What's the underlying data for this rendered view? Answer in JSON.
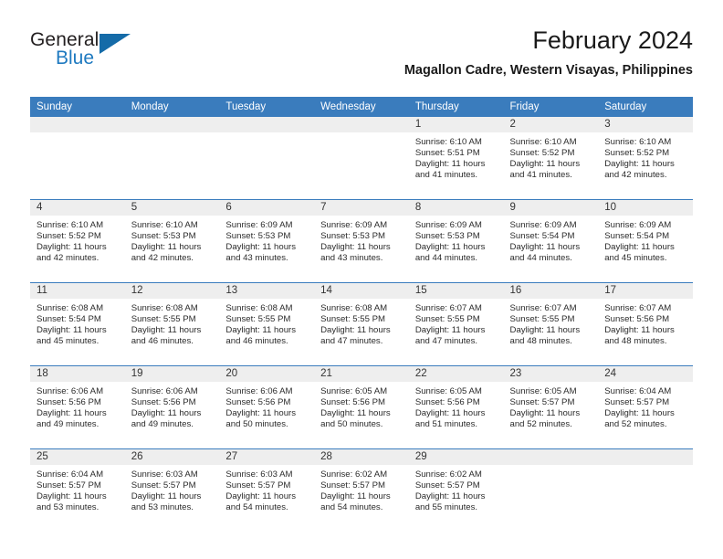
{
  "brand": {
    "name_part1": "General",
    "name_part2": "Blue",
    "flag_icon": "triangle-flag-icon",
    "accent_color": "#1f7ac0"
  },
  "header": {
    "title": "February 2024",
    "subtitle": "Magallon Cadre, Western Visayas, Philippines"
  },
  "theme": {
    "header_row_bg": "#3a7cbd",
    "daynum_band_bg": "#eeeeee",
    "grid_line": "#3a7cbd",
    "text": "#2b2b2b"
  },
  "weekday_headers": [
    "Sunday",
    "Monday",
    "Tuesday",
    "Wednesday",
    "Thursday",
    "Friday",
    "Saturday"
  ],
  "weeks": [
    [
      {
        "day": "",
        "lines": []
      },
      {
        "day": "",
        "lines": []
      },
      {
        "day": "",
        "lines": []
      },
      {
        "day": "",
        "lines": []
      },
      {
        "day": "1",
        "lines": [
          "Sunrise: 6:10 AM",
          "Sunset: 5:51 PM",
          "Daylight: 11 hours",
          "and 41 minutes."
        ]
      },
      {
        "day": "2",
        "lines": [
          "Sunrise: 6:10 AM",
          "Sunset: 5:52 PM",
          "Daylight: 11 hours",
          "and 41 minutes."
        ]
      },
      {
        "day": "3",
        "lines": [
          "Sunrise: 6:10 AM",
          "Sunset: 5:52 PM",
          "Daylight: 11 hours",
          "and 42 minutes."
        ]
      }
    ],
    [
      {
        "day": "4",
        "lines": [
          "Sunrise: 6:10 AM",
          "Sunset: 5:52 PM",
          "Daylight: 11 hours",
          "and 42 minutes."
        ]
      },
      {
        "day": "5",
        "lines": [
          "Sunrise: 6:10 AM",
          "Sunset: 5:53 PM",
          "Daylight: 11 hours",
          "and 42 minutes."
        ]
      },
      {
        "day": "6",
        "lines": [
          "Sunrise: 6:09 AM",
          "Sunset: 5:53 PM",
          "Daylight: 11 hours",
          "and 43 minutes."
        ]
      },
      {
        "day": "7",
        "lines": [
          "Sunrise: 6:09 AM",
          "Sunset: 5:53 PM",
          "Daylight: 11 hours",
          "and 43 minutes."
        ]
      },
      {
        "day": "8",
        "lines": [
          "Sunrise: 6:09 AM",
          "Sunset: 5:53 PM",
          "Daylight: 11 hours",
          "and 44 minutes."
        ]
      },
      {
        "day": "9",
        "lines": [
          "Sunrise: 6:09 AM",
          "Sunset: 5:54 PM",
          "Daylight: 11 hours",
          "and 44 minutes."
        ]
      },
      {
        "day": "10",
        "lines": [
          "Sunrise: 6:09 AM",
          "Sunset: 5:54 PM",
          "Daylight: 11 hours",
          "and 45 minutes."
        ]
      }
    ],
    [
      {
        "day": "11",
        "lines": [
          "Sunrise: 6:08 AM",
          "Sunset: 5:54 PM",
          "Daylight: 11 hours",
          "and 45 minutes."
        ]
      },
      {
        "day": "12",
        "lines": [
          "Sunrise: 6:08 AM",
          "Sunset: 5:55 PM",
          "Daylight: 11 hours",
          "and 46 minutes."
        ]
      },
      {
        "day": "13",
        "lines": [
          "Sunrise: 6:08 AM",
          "Sunset: 5:55 PM",
          "Daylight: 11 hours",
          "and 46 minutes."
        ]
      },
      {
        "day": "14",
        "lines": [
          "Sunrise: 6:08 AM",
          "Sunset: 5:55 PM",
          "Daylight: 11 hours",
          "and 47 minutes."
        ]
      },
      {
        "day": "15",
        "lines": [
          "Sunrise: 6:07 AM",
          "Sunset: 5:55 PM",
          "Daylight: 11 hours",
          "and 47 minutes."
        ]
      },
      {
        "day": "16",
        "lines": [
          "Sunrise: 6:07 AM",
          "Sunset: 5:55 PM",
          "Daylight: 11 hours",
          "and 48 minutes."
        ]
      },
      {
        "day": "17",
        "lines": [
          "Sunrise: 6:07 AM",
          "Sunset: 5:56 PM",
          "Daylight: 11 hours",
          "and 48 minutes."
        ]
      }
    ],
    [
      {
        "day": "18",
        "lines": [
          "Sunrise: 6:06 AM",
          "Sunset: 5:56 PM",
          "Daylight: 11 hours",
          "and 49 minutes."
        ]
      },
      {
        "day": "19",
        "lines": [
          "Sunrise: 6:06 AM",
          "Sunset: 5:56 PM",
          "Daylight: 11 hours",
          "and 49 minutes."
        ]
      },
      {
        "day": "20",
        "lines": [
          "Sunrise: 6:06 AM",
          "Sunset: 5:56 PM",
          "Daylight: 11 hours",
          "and 50 minutes."
        ]
      },
      {
        "day": "21",
        "lines": [
          "Sunrise: 6:05 AM",
          "Sunset: 5:56 PM",
          "Daylight: 11 hours",
          "and 50 minutes."
        ]
      },
      {
        "day": "22",
        "lines": [
          "Sunrise: 6:05 AM",
          "Sunset: 5:56 PM",
          "Daylight: 11 hours",
          "and 51 minutes."
        ]
      },
      {
        "day": "23",
        "lines": [
          "Sunrise: 6:05 AM",
          "Sunset: 5:57 PM",
          "Daylight: 11 hours",
          "and 52 minutes."
        ]
      },
      {
        "day": "24",
        "lines": [
          "Sunrise: 6:04 AM",
          "Sunset: 5:57 PM",
          "Daylight: 11 hours",
          "and 52 minutes."
        ]
      }
    ],
    [
      {
        "day": "25",
        "lines": [
          "Sunrise: 6:04 AM",
          "Sunset: 5:57 PM",
          "Daylight: 11 hours",
          "and 53 minutes."
        ]
      },
      {
        "day": "26",
        "lines": [
          "Sunrise: 6:03 AM",
          "Sunset: 5:57 PM",
          "Daylight: 11 hours",
          "and 53 minutes."
        ]
      },
      {
        "day": "27",
        "lines": [
          "Sunrise: 6:03 AM",
          "Sunset: 5:57 PM",
          "Daylight: 11 hours",
          "and 54 minutes."
        ]
      },
      {
        "day": "28",
        "lines": [
          "Sunrise: 6:02 AM",
          "Sunset: 5:57 PM",
          "Daylight: 11 hours",
          "and 54 minutes."
        ]
      },
      {
        "day": "29",
        "lines": [
          "Sunrise: 6:02 AM",
          "Sunset: 5:57 PM",
          "Daylight: 11 hours",
          "and 55 minutes."
        ]
      },
      {
        "day": "",
        "lines": []
      },
      {
        "day": "",
        "lines": []
      }
    ]
  ]
}
